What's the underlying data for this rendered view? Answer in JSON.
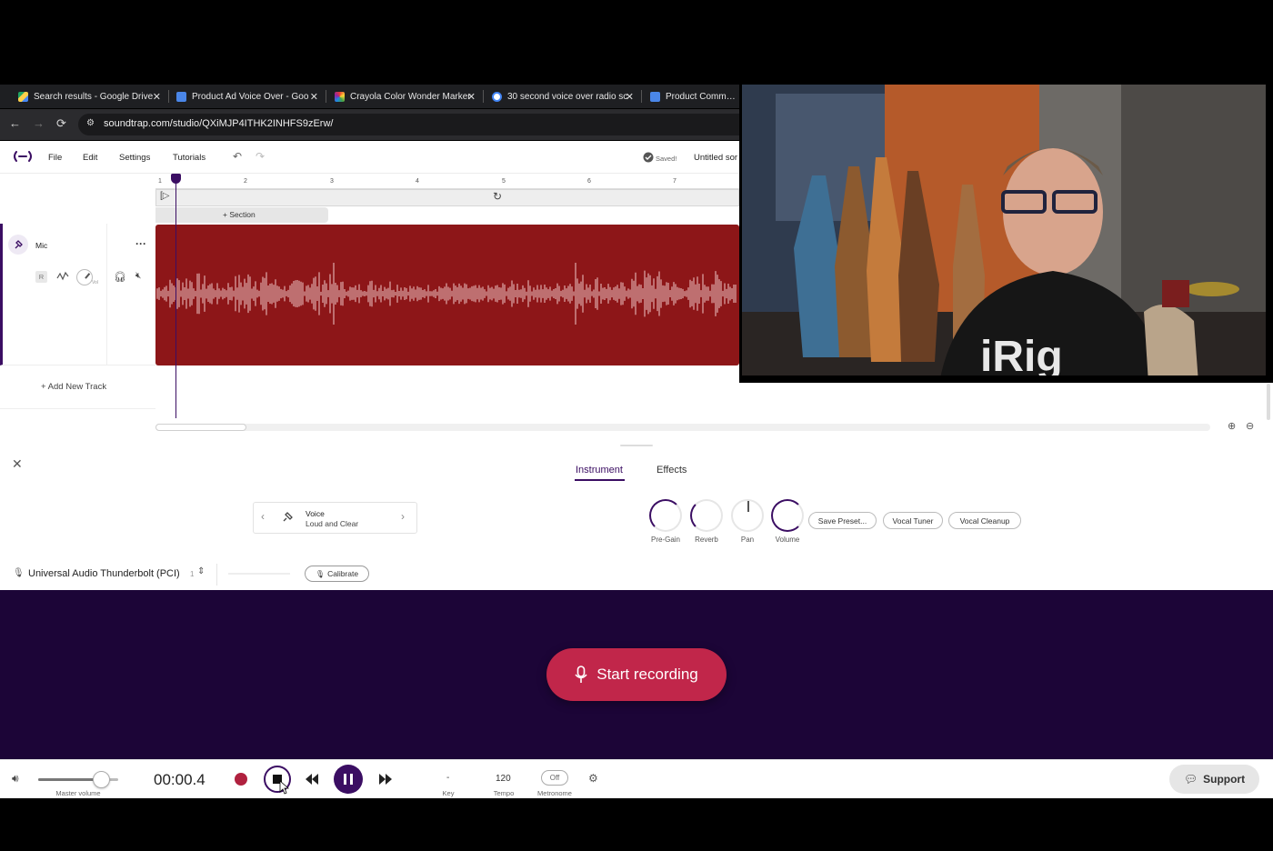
{
  "browser": {
    "tabs": [
      {
        "title": "Search results - Google Drive",
        "icon": "google-drive-icon",
        "color": "#f2b400"
      },
      {
        "title": "Product Ad Voice Over - Goo",
        "icon": "google-docs-icon",
        "color": "#4a86e8"
      },
      {
        "title": "Crayola Color Wonder Marker",
        "icon": "crayola-icon",
        "color": "#9c3fbf"
      },
      {
        "title": "30 second voice over radio sc",
        "icon": "google-icon",
        "color": "#ffffff"
      },
      {
        "title": "Product Commercia",
        "icon": "google-docs-icon",
        "color": "#4a86e8"
      }
    ],
    "url": "soundtrap.com/studio/QXiMJP4ITHK2INHFS9zErw/"
  },
  "menu": {
    "items": [
      "File",
      "Edit",
      "Settings",
      "Tutorials"
    ],
    "saved_status": "Saved!",
    "project_title": "Untitled sor"
  },
  "timeline": {
    "ruler_ticks": [
      "1",
      "2",
      "3",
      "4",
      "5",
      "6",
      "7"
    ],
    "add_section_label": "+ Section",
    "add_track_label": "+ Add New Track"
  },
  "track": {
    "name": "Mic",
    "record_arm_label": "R",
    "vol_label": "Vol",
    "clip_color": "#8d1618"
  },
  "editor": {
    "tabs": [
      "Instrument",
      "Effects"
    ],
    "active_tab": "Instrument",
    "preset": {
      "name": "Voice",
      "variant": "Loud and Clear"
    },
    "knobs": [
      {
        "label": "Pre-Gain",
        "level": 0.45
      },
      {
        "label": "Reverb",
        "level": 0.15
      },
      {
        "label": "Pan",
        "level": 0.5
      },
      {
        "label": "Volume",
        "level": 0.6
      }
    ],
    "buttons": [
      "Save Preset...",
      "Vocal Tuner",
      "Vocal Cleanup"
    ],
    "input_device": "Universal Audio Thunderbolt (PCI)",
    "input_channel": "1",
    "calibrate_label": "Calibrate"
  },
  "record": {
    "label": "Start recording",
    "color": "#c1264a"
  },
  "transport": {
    "master_volume_label": "Master volume",
    "master_volume_level": 0.78,
    "time": "00:00.4",
    "key_value": "-",
    "key_label": "Key",
    "tempo_value": "120",
    "tempo_label": "Tempo",
    "metronome_value": "Off",
    "metronome_label": "Metronome",
    "support_label": "Support"
  },
  "colors": {
    "accent": "#3b0e63",
    "record_red": "#c1264a",
    "panel_bg": "#1c0537"
  }
}
